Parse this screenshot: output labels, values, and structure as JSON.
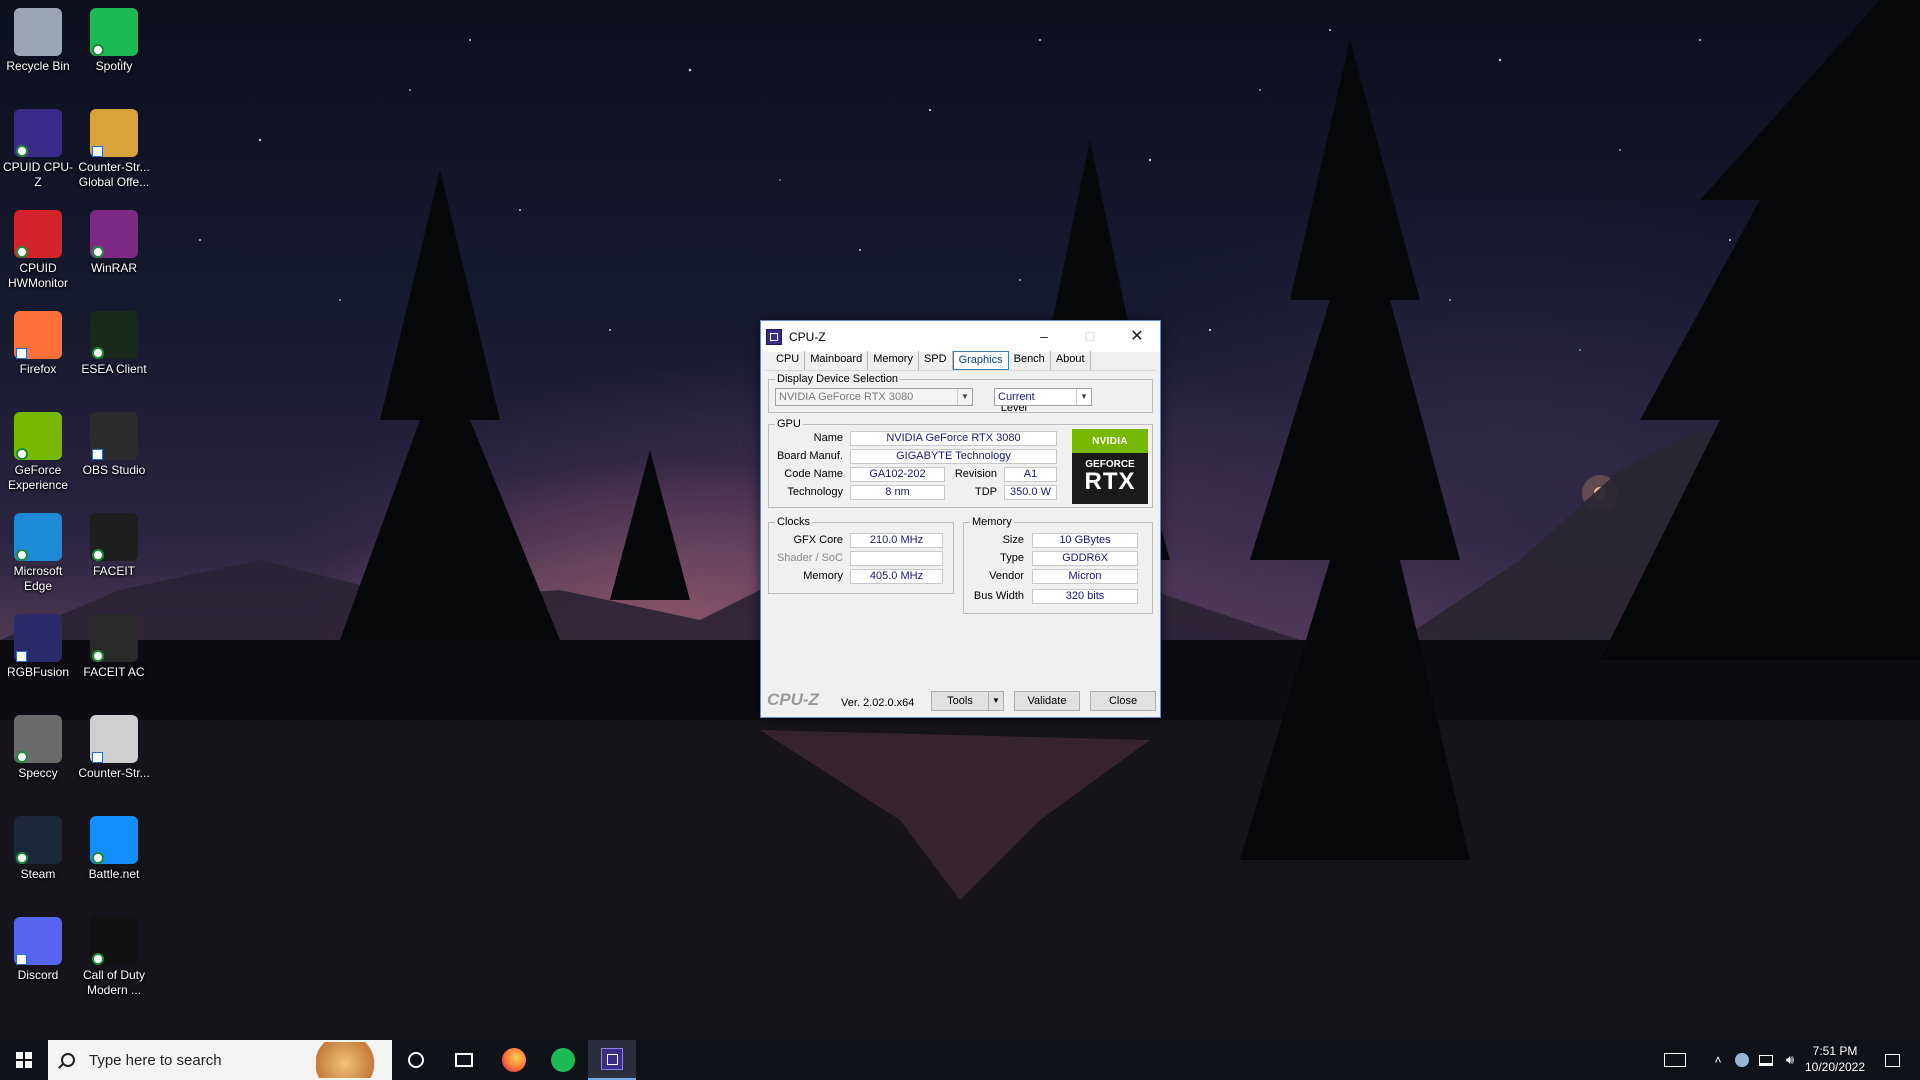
{
  "desktop": {
    "icons": [
      {
        "label": "Recycle Bin",
        "icon": "recycle-bin-icon",
        "color": "#9aa6b2"
      },
      {
        "label": "Spotify",
        "icon": "spotify-icon",
        "color": "#1db954"
      },
      {
        "label": "CPUID CPU-Z",
        "icon": "cpuz-icon",
        "color": "#3b2c8a"
      },
      {
        "label": "Counter-Str... Global Offe...",
        "icon": "csgo-icon",
        "color": "#d9a23a"
      },
      {
        "label": "CPUID HWMonitor",
        "icon": "hwmonitor-icon",
        "color": "#d4232b"
      },
      {
        "label": "WinRAR",
        "icon": "winrar-icon",
        "color": "#7d2a86"
      },
      {
        "label": "Firefox",
        "icon": "firefox-icon",
        "color": "#ff7139"
      },
      {
        "label": "ESEA Client",
        "icon": "esea-icon",
        "color": "#1a2a1a"
      },
      {
        "label": "GeForce Experience",
        "icon": "geforce-experience-icon",
        "color": "#76b900"
      },
      {
        "label": "OBS Studio",
        "icon": "obs-icon",
        "color": "#2b2b2b"
      },
      {
        "label": "Microsoft Edge",
        "icon": "edge-icon",
        "color": "#1c8ad6"
      },
      {
        "label": "FACEIT",
        "icon": "faceit-icon",
        "color": "#1f1f1f"
      },
      {
        "label": "RGBFusion",
        "icon": "rgbfusion-icon",
        "color": "#2b2b6b"
      },
      {
        "label": "FACEIT AC",
        "icon": "faceit-ac-icon",
        "color": "#2a2a2a"
      },
      {
        "label": "Speccy",
        "icon": "speccy-icon",
        "color": "#6b6b6b"
      },
      {
        "label": "Counter-Str...",
        "icon": "counter-strike-icon",
        "color": "#cfcfcf"
      },
      {
        "label": "Steam",
        "icon": "steam-icon",
        "color": "#1b2838"
      },
      {
        "label": "Battle.net",
        "icon": "battlenet-icon",
        "color": "#148eff"
      },
      {
        "label": "Discord",
        "icon": "discord-icon",
        "color": "#5865f2"
      },
      {
        "label": "Call of Duty Modern ...",
        "icon": "mw-icon",
        "color": "#111111"
      }
    ]
  },
  "cpuz": {
    "window_title": "CPU-Z",
    "tabs": [
      "CPU",
      "Mainboard",
      "Memory",
      "SPD",
      "Graphics",
      "Bench",
      "About"
    ],
    "active_tab": "Graphics",
    "display_device": {
      "group_title": "Display Device Selection",
      "device": "NVIDIA GeForce RTX 3080",
      "perf_level_label": "Perf Level",
      "perf_level": "Current"
    },
    "gpu": {
      "group_title": "GPU",
      "name_label": "Name",
      "name": "NVIDIA GeForce RTX 3080",
      "board_label": "Board Manuf.",
      "board": "GIGABYTE Technology",
      "code_label": "Code Name",
      "code": "GA102-202",
      "revision_label": "Revision",
      "revision": "A1",
      "tech_label": "Technology",
      "tech": "8 nm",
      "tdp_label": "TDP",
      "tdp": "350.0 W"
    },
    "logo": {
      "brand": "NVIDIA",
      "line1": "GEFORCE",
      "line2": "RTX",
      "accent": "#76b900"
    },
    "clocks": {
      "group_title": "Clocks",
      "gfx_label": "GFX Core",
      "gfx": "210.0 MHz",
      "shader_label": "Shader / SoC",
      "shader": "",
      "mem_label": "Memory",
      "mem": "405.0 MHz"
    },
    "memory": {
      "group_title": "Memory",
      "size_label": "Size",
      "size": "10 GBytes",
      "type_label": "Type",
      "type": "GDDR6X",
      "vendor_label": "Vendor",
      "vendor": "Micron",
      "bus_label": "Bus Width",
      "bus": "320 bits"
    },
    "footer": {
      "brand": "CPU-Z",
      "version": "Ver. 2.02.0.x64",
      "tools": "Tools",
      "validate": "Validate",
      "close": "Close"
    }
  },
  "taskbar": {
    "search_placeholder": "Type here to search",
    "time": "7:51 PM",
    "date": "10/20/2022"
  }
}
